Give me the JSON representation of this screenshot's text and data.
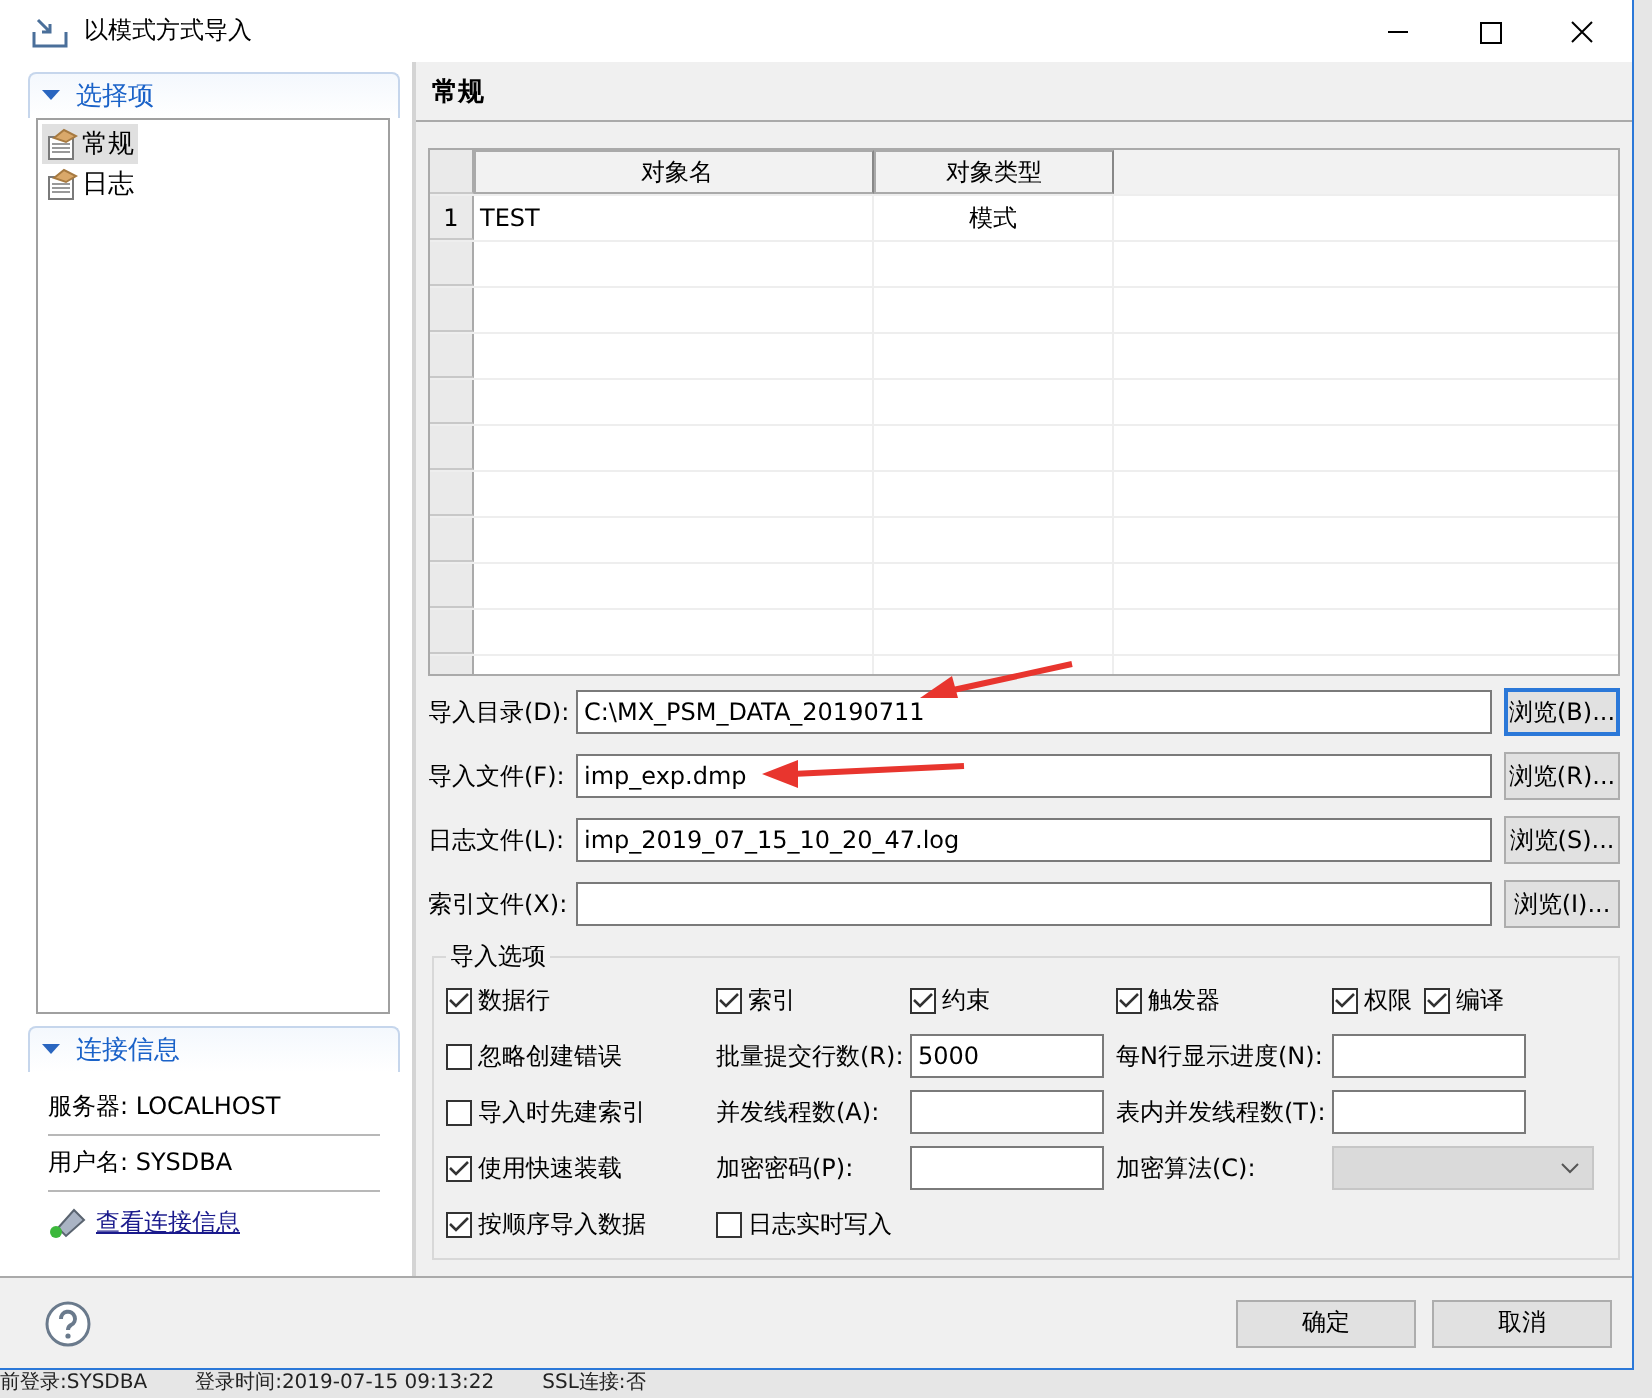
{
  "window": {
    "title": "以模式方式导入"
  },
  "sidebar": {
    "sections": [
      {
        "title": "选择项",
        "expanded": true
      },
      {
        "title": "连接信息",
        "expanded": true
      }
    ],
    "items": [
      {
        "label": "常规",
        "selected": true
      },
      {
        "label": "日志",
        "selected": false
      }
    ],
    "connection": [
      "服务器: LOCALHOST",
      "用户名: SYSDBA"
    ],
    "link": "查看连接信息"
  },
  "panel": {
    "title": "常规"
  },
  "table": {
    "columns": [
      "对象名",
      "对象类型"
    ],
    "rows": [
      {
        "number": "1",
        "cells": [
          "TEST",
          "模式"
        ]
      }
    ]
  },
  "files": [
    {
      "label": "导入目录(D):",
      "value": "C:\\MX_PSM_DATA_20190711",
      "button": "浏览(B)...",
      "focused": true
    },
    {
      "label": "导入文件(F):",
      "value": "imp_exp.dmp",
      "button": "浏览(R)...",
      "focused": false
    },
    {
      "label": "日志文件(L):",
      "value": "imp_2019_07_15_10_20_47.log",
      "button": "浏览(S)...",
      "focused": false
    },
    {
      "label": "索引文件(X):",
      "button": "浏览(I)...",
      "focused": false
    }
  ],
  "options": {
    "title": "导入选项",
    "checks": [
      {
        "label": "数据行",
        "checked": true
      },
      {
        "label": "索引",
        "checked": true
      },
      {
        "label": "约束",
        "checked": true
      },
      {
        "label": "触发器",
        "checked": true
      },
      {
        "label": "权限",
        "checked": true
      },
      {
        "label": "编译",
        "checked": true
      }
    ],
    "rows": [
      [
        {
          "kind": "checkbox",
          "label": "忽略创建错误",
          "checked": false
        },
        {
          "kind": "field",
          "label": "批量提交行数(R):",
          "value": "5000"
        },
        {
          "kind": "field",
          "label": "每N行显示进度(N):"
        }
      ],
      [
        {
          "kind": "checkbox",
          "label": "导入时先建索引",
          "checked": false
        },
        {
          "kind": "field",
          "label": "并发线程数(A):"
        },
        {
          "kind": "field",
          "label": "表内并发线程数(T):"
        }
      ],
      [
        {
          "kind": "checkbox",
          "label": "使用快速装载",
          "checked": true
        },
        {
          "kind": "field",
          "label": "加密密码(P):"
        },
        {
          "kind": "select",
          "label": "加密算法(C):",
          "disabled": true
        }
      ],
      [
        {
          "kind": "checkbox",
          "label": "按顺序导入数据",
          "checked": true
        },
        {
          "kind": "checkbox",
          "label": "日志实时写入",
          "checked": false
        }
      ]
    ]
  },
  "buttons": [
    "确定",
    "取消"
  ],
  "status_bar": [
    "前登录:SYSDBA",
    "登录时间:2019-07-15 09:13:22",
    "SSL连接:否"
  ]
}
